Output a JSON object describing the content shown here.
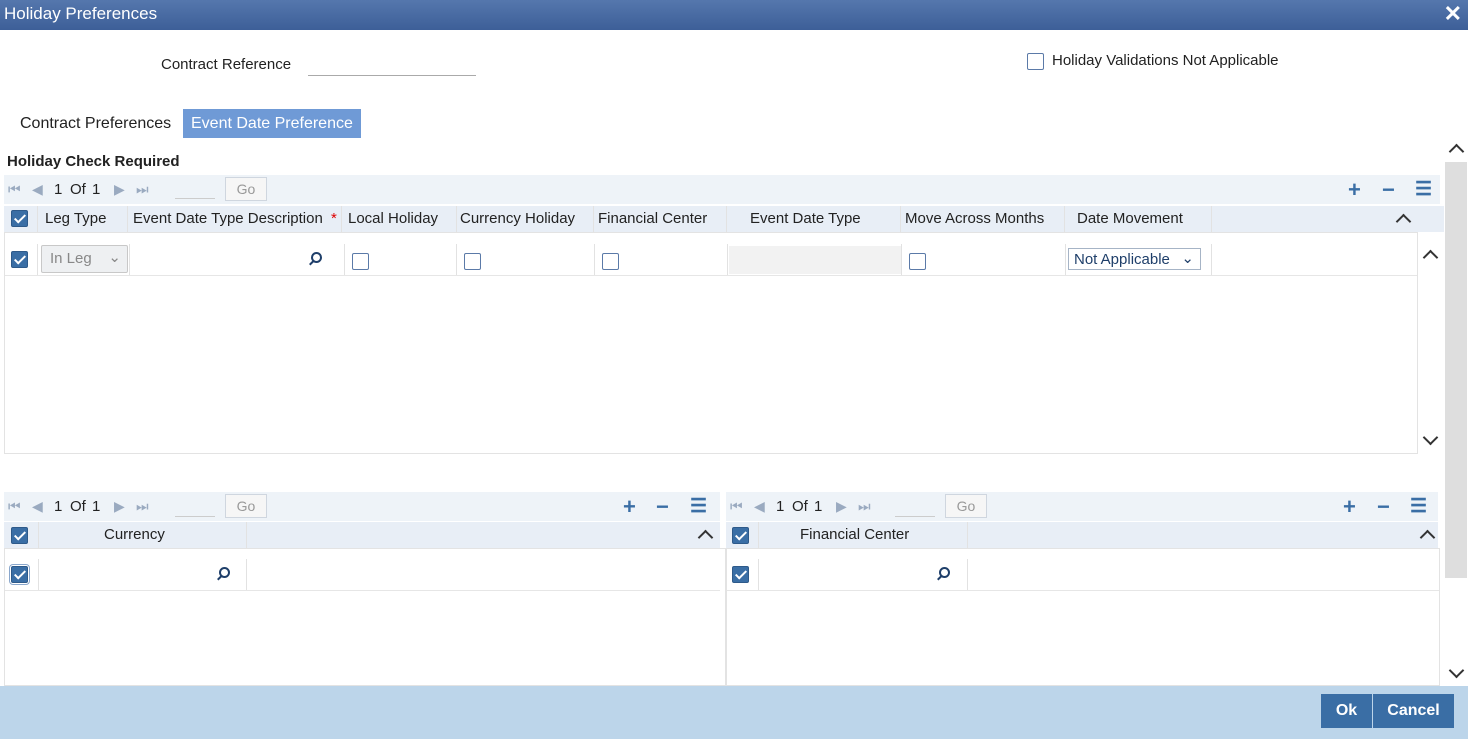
{
  "window": {
    "title": "Holiday Preferences",
    "close_glyph": "✕"
  },
  "contract_reference": {
    "label": "Contract Reference",
    "value": ""
  },
  "holiday_validations": {
    "label": "Holiday Validations Not Applicable",
    "checked": false
  },
  "tabs": [
    {
      "label": "Contract Preferences",
      "active": false
    },
    {
      "label": "Event Date Preference",
      "active": true
    }
  ],
  "section": {
    "title": "Holiday Check Required"
  },
  "main_grid": {
    "pager": {
      "current": "1",
      "of_label": "Of",
      "total": "1",
      "go_label": "Go"
    },
    "columns": [
      "Leg Type",
      "Event Date Type Description",
      "Local Holiday",
      "Currency Holiday",
      "Financial Center",
      "Event Date Type",
      "Move Across Months",
      "Date Movement"
    ],
    "required_marker": "*",
    "rows": [
      {
        "selected": true,
        "leg_type": "In Leg",
        "event_date_type_description": "",
        "local_holiday": false,
        "currency_holiday": false,
        "financial_center": false,
        "event_date_type": "",
        "move_across_months": false,
        "date_movement": "Not Applicable"
      }
    ]
  },
  "currency_grid": {
    "pager": {
      "current": "1",
      "of_label": "Of",
      "total": "1",
      "go_label": "Go"
    },
    "columns": [
      "Currency"
    ],
    "rows": [
      {
        "selected": true,
        "currency": ""
      }
    ]
  },
  "financial_center_grid": {
    "pager": {
      "current": "1",
      "of_label": "Of",
      "total": "1",
      "go_label": "Go"
    },
    "columns": [
      "Financial Center"
    ],
    "rows": [
      {
        "selected": true,
        "financial_center": ""
      }
    ]
  },
  "buttons": {
    "ok": "Ok",
    "cancel": "Cancel"
  },
  "icons": {
    "first": "⏮",
    "prev": "◀",
    "next": "▶",
    "last": "⏭",
    "add": "+",
    "remove": "−",
    "columns": "☰",
    "dropdown": "⌄"
  },
  "colors": {
    "title_bar": "#3d5f98",
    "accent": "#3a6ea5",
    "tab_active": "#6f9ad6",
    "footer": "#bcd5ea"
  }
}
